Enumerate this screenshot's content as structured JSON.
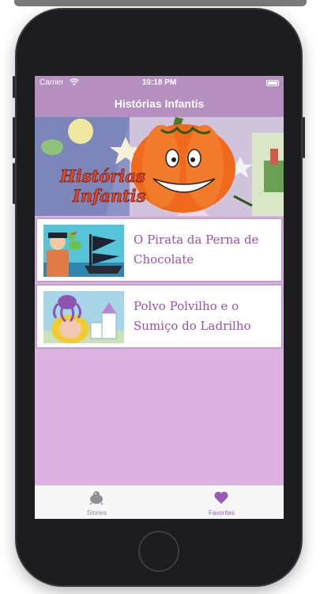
{
  "status_bar": {
    "carrier": "Carrier",
    "time": "10:18 PM"
  },
  "nav": {
    "title": "Histórias Infantis"
  },
  "banner": {
    "logo_line1": "Histórias",
    "logo_line2": "Infantis"
  },
  "stories": [
    {
      "title": "O Pirata da Perna de Chocolate"
    },
    {
      "title": "Polvo Polvilho e o Sumiço do Ladrilho"
    }
  ],
  "tabs": [
    {
      "label": "Stories",
      "icon": "stories-icon",
      "color": "#8e8e93"
    },
    {
      "label": "Favorites",
      "icon": "heart-icon",
      "color": "#9b59b6"
    }
  ],
  "colors": {
    "nav": "#b48fc0",
    "background": "#dcb3e0",
    "title_text": "#9c4fb0"
  }
}
